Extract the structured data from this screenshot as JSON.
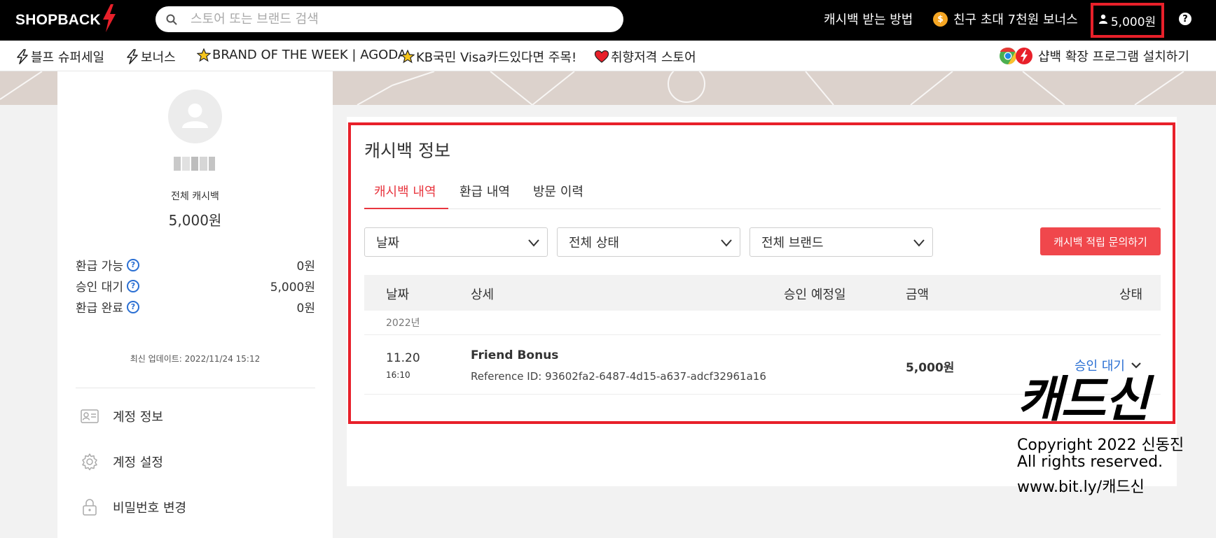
{
  "topbar": {
    "brand": "SHOPBACK",
    "search_placeholder": "스토어 또는 브랜드 검색",
    "how_to": "캐시백 받는 방법",
    "invite": "친구 초대 7천원 보너스",
    "invite_coin": "$",
    "account_balance": "5,000원",
    "help": "?"
  },
  "subnav": {
    "items": [
      {
        "label": "블프 슈퍼세일",
        "icon": "lightning-icon"
      },
      {
        "label": "보너스",
        "icon": "lightning-icon"
      },
      {
        "label": "BRAND OF THE WEEK | AGODA",
        "icon": "star-icon"
      },
      {
        "label": "KB국민 Visa카드있다면 주목!",
        "icon": "star-icon"
      },
      {
        "label": "취향저격 스토어",
        "icon": "heart-icon"
      }
    ],
    "extension": "샵백 확장 프로그램 설치하기"
  },
  "sidebar": {
    "total_label": "전체 캐시백",
    "total_value": "5,000원",
    "stats": [
      {
        "label": "환급 가능",
        "value": "0원"
      },
      {
        "label": "승인 대기",
        "value": "5,000원"
      },
      {
        "label": "환급 완료",
        "value": "0원"
      }
    ],
    "last_update": "최신 업데이트: 2022/11/24 15:12",
    "menu": [
      {
        "label": "계정 정보",
        "icon": "id-card-icon"
      },
      {
        "label": "계정 설정",
        "icon": "gear-icon"
      },
      {
        "label": "비밀번호 변경",
        "icon": "lock-icon"
      }
    ]
  },
  "main": {
    "title": "캐시백 정보",
    "tabs": [
      "캐시백 내역",
      "환급 내역",
      "방문 이력"
    ],
    "filters": [
      "날짜",
      "전체 상태",
      "전체 브랜드"
    ],
    "inquiry_button": "캐시백 적립 문의하기",
    "table": {
      "headers": [
        "날짜",
        "상세",
        "승인 예정일",
        "금액",
        "상태"
      ],
      "year": "2022년",
      "rows": [
        {
          "date": "11.20",
          "time": "16:10",
          "title": "Friend Bonus",
          "reference": "Reference ID: 93602fa2-6487-4d15-a637-adcf32961a16",
          "amount": "5,000원",
          "status": "승인 대기"
        }
      ]
    }
  },
  "watermark": {
    "title": "캐드신",
    "lines": [
      "Copyright 2022 신동진",
      "All rights reserved.",
      "www.bit.ly/캐드신"
    ]
  },
  "colors": {
    "accent_red": "#e8363f",
    "outline_red": "#e8202a",
    "link_blue": "#2a6fd3",
    "button_red": "#f0474c"
  }
}
